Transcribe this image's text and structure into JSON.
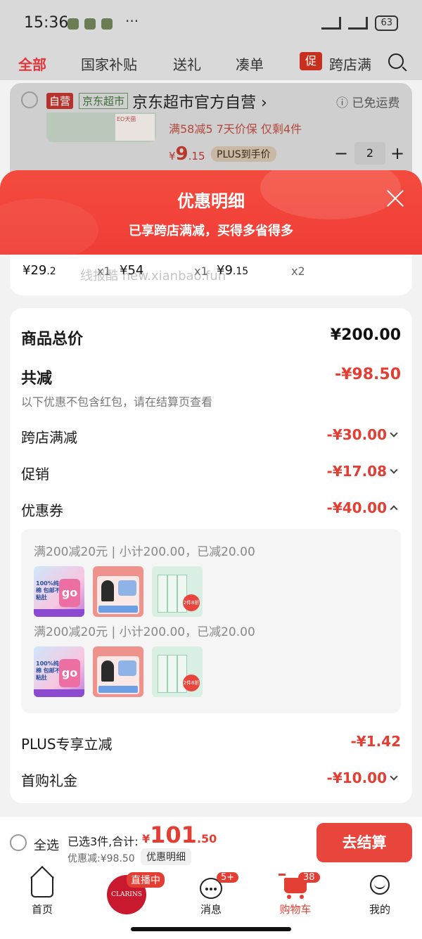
{
  "status": {
    "time": "15:36",
    "more": "···",
    "battery": "63"
  },
  "tabs": [
    {
      "label": "全部"
    },
    {
      "label": "国家补贴"
    },
    {
      "label": "送礼"
    },
    {
      "label": "凑单"
    },
    {
      "label": "跨店满"
    }
  ],
  "tab_badge": "促",
  "bg_item": {
    "self_tag": "自营",
    "store_tag": "京东超市",
    "store_name": "京东超市官方自营 ›",
    "shipping": "ⓘ 已免运费",
    "thumb_text": "EO天菌",
    "promo": "满58减5  7天价保  仅剩4件",
    "price_yen": "¥",
    "price_int": "9",
    "price_dec": ".15",
    "plus_label": "PLUS到手价",
    "qty": "2",
    "minus": "−",
    "plus": "+"
  },
  "sheet": {
    "title": "优惠明细",
    "subtitle": "已享跨店满减，买得多省得多"
  },
  "items_strip": [
    {
      "yen_int": "¥29",
      "dec": ".2",
      "qty": "x1"
    },
    {
      "yen_int": "¥54",
      "dec": "",
      "qty": "x1"
    },
    {
      "yen_int": "¥9",
      "dec": ".15",
      "qty": "x2"
    }
  ],
  "watermark": "线报酷 new.xianbao.fun",
  "summary": {
    "total_label": "商品总价",
    "total_value": "¥200.00",
    "reduce_label": "共减",
    "reduce_value": "-¥98.50",
    "reduce_note": "以下优惠不包含红包，请在结算页查看",
    "rows": [
      {
        "label": "跨店满减",
        "value": "-¥30.00"
      },
      {
        "label": "促销",
        "value": "-¥17.08"
      },
      {
        "label": "优惠券",
        "value": "-¥40.00"
      }
    ],
    "coupons": [
      {
        "text": "满200减20元 | 小计200.00，已减20.00"
      },
      {
        "text": "满200减20元 | 小计200.00，已减20.00"
      }
    ],
    "thumb_go": "go",
    "thumb_text": "100%纯棉 包邮不粘肚",
    "thumb_sale": "2件8折",
    "plus_label": "PLUS专享立减",
    "plus_value": "-¥1.42",
    "gift_label": "首购礼金",
    "gift_value": "-¥10.00"
  },
  "checkout": {
    "select_all": "全选",
    "selected": "已选3件,合计:",
    "price_yen": "¥",
    "price_int": "101",
    "price_dec": ".50",
    "discount": "优惠减:¥98.50",
    "discount_detail": "优惠明细",
    "button": "去结算"
  },
  "nav": {
    "home": "首页",
    "live_badge": "直播中",
    "live_avatar": "CLARINS",
    "messages": "消息",
    "messages_badge": "5+",
    "cart": "购物车",
    "cart_badge": "38",
    "me": "我的"
  }
}
